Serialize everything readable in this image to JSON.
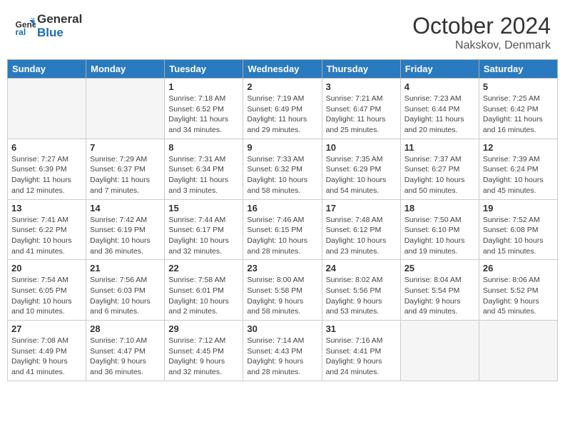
{
  "header": {
    "logo_text_general": "General",
    "logo_text_blue": "Blue",
    "month": "October 2024",
    "location": "Nakskov, Denmark"
  },
  "weekdays": [
    "Sunday",
    "Monday",
    "Tuesday",
    "Wednesday",
    "Thursday",
    "Friday",
    "Saturday"
  ],
  "weeks": [
    [
      {
        "day": "",
        "sunrise": "",
        "sunset": "",
        "daylight": ""
      },
      {
        "day": "",
        "sunrise": "",
        "sunset": "",
        "daylight": ""
      },
      {
        "day": "1",
        "sunrise": "Sunrise: 7:18 AM",
        "sunset": "Sunset: 6:52 PM",
        "daylight": "Daylight: 11 hours and 34 minutes."
      },
      {
        "day": "2",
        "sunrise": "Sunrise: 7:19 AM",
        "sunset": "Sunset: 6:49 PM",
        "daylight": "Daylight: 11 hours and 29 minutes."
      },
      {
        "day": "3",
        "sunrise": "Sunrise: 7:21 AM",
        "sunset": "Sunset: 6:47 PM",
        "daylight": "Daylight: 11 hours and 25 minutes."
      },
      {
        "day": "4",
        "sunrise": "Sunrise: 7:23 AM",
        "sunset": "Sunset: 6:44 PM",
        "daylight": "Daylight: 11 hours and 20 minutes."
      },
      {
        "day": "5",
        "sunrise": "Sunrise: 7:25 AM",
        "sunset": "Sunset: 6:42 PM",
        "daylight": "Daylight: 11 hours and 16 minutes."
      }
    ],
    [
      {
        "day": "6",
        "sunrise": "Sunrise: 7:27 AM",
        "sunset": "Sunset: 6:39 PM",
        "daylight": "Daylight: 11 hours and 12 minutes."
      },
      {
        "day": "7",
        "sunrise": "Sunrise: 7:29 AM",
        "sunset": "Sunset: 6:37 PM",
        "daylight": "Daylight: 11 hours and 7 minutes."
      },
      {
        "day": "8",
        "sunrise": "Sunrise: 7:31 AM",
        "sunset": "Sunset: 6:34 PM",
        "daylight": "Daylight: 11 hours and 3 minutes."
      },
      {
        "day": "9",
        "sunrise": "Sunrise: 7:33 AM",
        "sunset": "Sunset: 6:32 PM",
        "daylight": "Daylight: 10 hours and 58 minutes."
      },
      {
        "day": "10",
        "sunrise": "Sunrise: 7:35 AM",
        "sunset": "Sunset: 6:29 PM",
        "daylight": "Daylight: 10 hours and 54 minutes."
      },
      {
        "day": "11",
        "sunrise": "Sunrise: 7:37 AM",
        "sunset": "Sunset: 6:27 PM",
        "daylight": "Daylight: 10 hours and 50 minutes."
      },
      {
        "day": "12",
        "sunrise": "Sunrise: 7:39 AM",
        "sunset": "Sunset: 6:24 PM",
        "daylight": "Daylight: 10 hours and 45 minutes."
      }
    ],
    [
      {
        "day": "13",
        "sunrise": "Sunrise: 7:41 AM",
        "sunset": "Sunset: 6:22 PM",
        "daylight": "Daylight: 10 hours and 41 minutes."
      },
      {
        "day": "14",
        "sunrise": "Sunrise: 7:42 AM",
        "sunset": "Sunset: 6:19 PM",
        "daylight": "Daylight: 10 hours and 36 minutes."
      },
      {
        "day": "15",
        "sunrise": "Sunrise: 7:44 AM",
        "sunset": "Sunset: 6:17 PM",
        "daylight": "Daylight: 10 hours and 32 minutes."
      },
      {
        "day": "16",
        "sunrise": "Sunrise: 7:46 AM",
        "sunset": "Sunset: 6:15 PM",
        "daylight": "Daylight: 10 hours and 28 minutes."
      },
      {
        "day": "17",
        "sunrise": "Sunrise: 7:48 AM",
        "sunset": "Sunset: 6:12 PM",
        "daylight": "Daylight: 10 hours and 23 minutes."
      },
      {
        "day": "18",
        "sunrise": "Sunrise: 7:50 AM",
        "sunset": "Sunset: 6:10 PM",
        "daylight": "Daylight: 10 hours and 19 minutes."
      },
      {
        "day": "19",
        "sunrise": "Sunrise: 7:52 AM",
        "sunset": "Sunset: 6:08 PM",
        "daylight": "Daylight: 10 hours and 15 minutes."
      }
    ],
    [
      {
        "day": "20",
        "sunrise": "Sunrise: 7:54 AM",
        "sunset": "Sunset: 6:05 PM",
        "daylight": "Daylight: 10 hours and 10 minutes."
      },
      {
        "day": "21",
        "sunrise": "Sunrise: 7:56 AM",
        "sunset": "Sunset: 6:03 PM",
        "daylight": "Daylight: 10 hours and 6 minutes."
      },
      {
        "day": "22",
        "sunrise": "Sunrise: 7:58 AM",
        "sunset": "Sunset: 6:01 PM",
        "daylight": "Daylight: 10 hours and 2 minutes."
      },
      {
        "day": "23",
        "sunrise": "Sunrise: 8:00 AM",
        "sunset": "Sunset: 5:58 PM",
        "daylight": "Daylight: 9 hours and 58 minutes."
      },
      {
        "day": "24",
        "sunrise": "Sunrise: 8:02 AM",
        "sunset": "Sunset: 5:56 PM",
        "daylight": "Daylight: 9 hours and 53 minutes."
      },
      {
        "day": "25",
        "sunrise": "Sunrise: 8:04 AM",
        "sunset": "Sunset: 5:54 PM",
        "daylight": "Daylight: 9 hours and 49 minutes."
      },
      {
        "day": "26",
        "sunrise": "Sunrise: 8:06 AM",
        "sunset": "Sunset: 5:52 PM",
        "daylight": "Daylight: 9 hours and 45 minutes."
      }
    ],
    [
      {
        "day": "27",
        "sunrise": "Sunrise: 7:08 AM",
        "sunset": "Sunset: 4:49 PM",
        "daylight": "Daylight: 9 hours and 41 minutes."
      },
      {
        "day": "28",
        "sunrise": "Sunrise: 7:10 AM",
        "sunset": "Sunset: 4:47 PM",
        "daylight": "Daylight: 9 hours and 36 minutes."
      },
      {
        "day": "29",
        "sunrise": "Sunrise: 7:12 AM",
        "sunset": "Sunset: 4:45 PM",
        "daylight": "Daylight: 9 hours and 32 minutes."
      },
      {
        "day": "30",
        "sunrise": "Sunrise: 7:14 AM",
        "sunset": "Sunset: 4:43 PM",
        "daylight": "Daylight: 9 hours and 28 minutes."
      },
      {
        "day": "31",
        "sunrise": "Sunrise: 7:16 AM",
        "sunset": "Sunset: 4:41 PM",
        "daylight": "Daylight: 9 hours and 24 minutes."
      },
      {
        "day": "",
        "sunrise": "",
        "sunset": "",
        "daylight": ""
      },
      {
        "day": "",
        "sunrise": "",
        "sunset": "",
        "daylight": ""
      }
    ]
  ]
}
